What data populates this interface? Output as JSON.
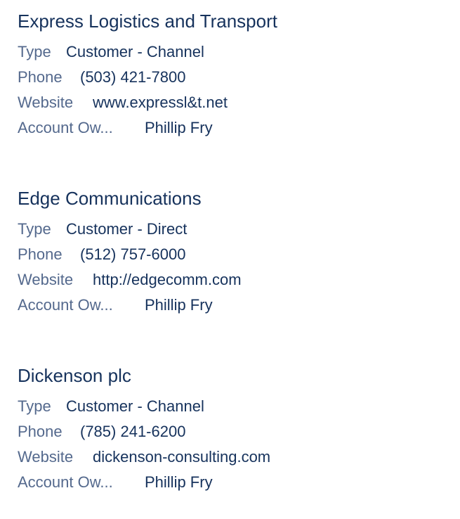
{
  "accounts": [
    {
      "name": "Express Logistics and Transport",
      "type_label": "Type",
      "type_value": "Customer - Channel",
      "phone_label": "Phone",
      "phone_value": "(503) 421-7800",
      "website_label": "Website",
      "website_value": "www.expressl&t.net",
      "owner_label": "Account Ow...",
      "owner_value": "Phillip Fry"
    },
    {
      "name": "Edge Communications",
      "type_label": "Type",
      "type_value": "Customer - Direct",
      "phone_label": "Phone",
      "phone_value": "(512) 757-6000",
      "website_label": "Website",
      "website_value": "http://edgecomm.com",
      "owner_label": "Account Ow...",
      "owner_value": "Phillip Fry"
    },
    {
      "name": "Dickenson plc",
      "type_label": "Type",
      "type_value": "Customer - Channel",
      "phone_label": "Phone",
      "phone_value": "(785) 241-6200",
      "website_label": "Website",
      "website_value": "dickenson-consulting.com",
      "owner_label": "Account Ow...",
      "owner_value": "Phillip Fry"
    }
  ],
  "colors": {
    "title": "#16325c",
    "label": "#54698d",
    "value": "#16325c"
  }
}
